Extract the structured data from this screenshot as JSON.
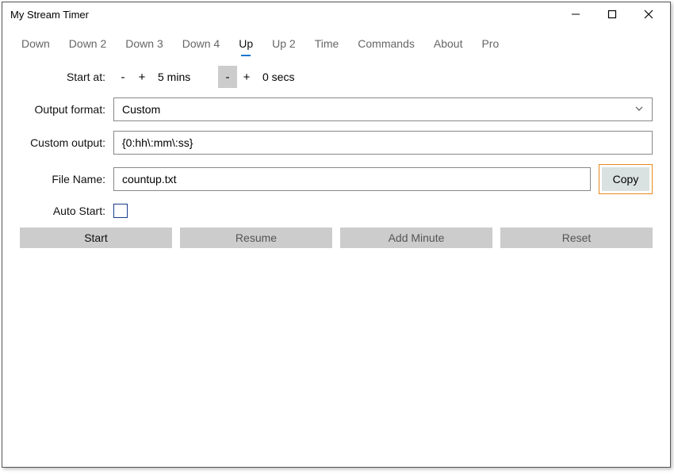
{
  "window": {
    "title": "My Stream Timer"
  },
  "tabs": [
    {
      "label": "Down",
      "active": false
    },
    {
      "label": "Down 2",
      "active": false
    },
    {
      "label": "Down 3",
      "active": false
    },
    {
      "label": "Down 4",
      "active": false
    },
    {
      "label": "Up",
      "active": true
    },
    {
      "label": "Up 2",
      "active": false
    },
    {
      "label": "Time",
      "active": false
    },
    {
      "label": "Commands",
      "active": false
    },
    {
      "label": "About",
      "active": false
    },
    {
      "label": "Pro",
      "active": false
    }
  ],
  "form": {
    "start_at_label": "Start at:",
    "mins_value": "5 mins",
    "secs_value": "0 secs",
    "minus": "-",
    "plus": "+",
    "output_format_label": "Output format:",
    "output_format_value": "Custom",
    "custom_output_label": "Custom output:",
    "custom_output_value": "{0:hh\\:mm\\:ss}",
    "file_name_label": "File Name:",
    "file_name_value": "countup.txt",
    "copy_label": "Copy",
    "auto_start_label": "Auto Start:",
    "auto_start_checked": false
  },
  "actions": {
    "start": "Start",
    "resume": "Resume",
    "add_minute": "Add Minute",
    "reset": "Reset"
  }
}
